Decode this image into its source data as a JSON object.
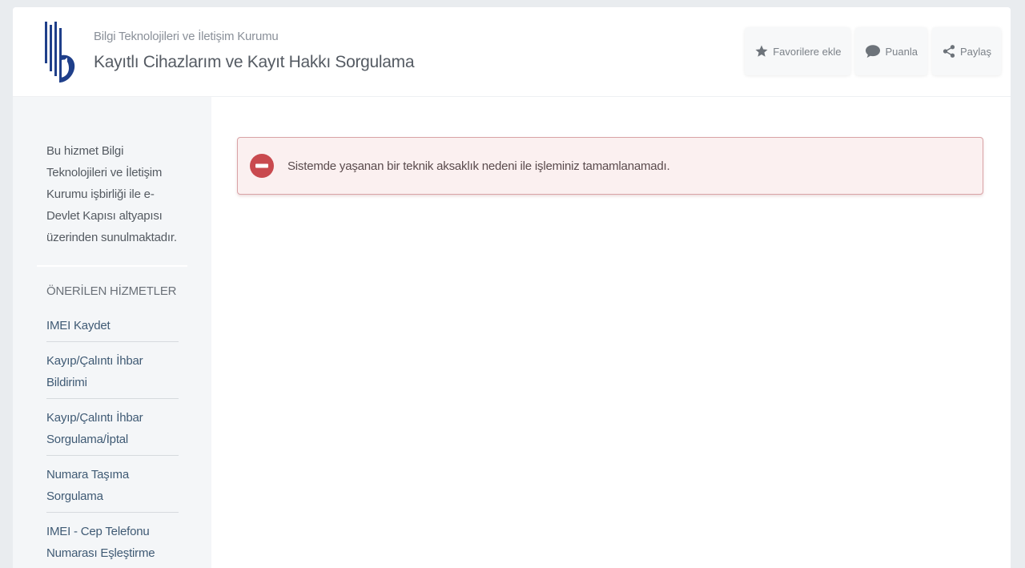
{
  "header": {
    "agency": "Bilgi Teknolojileri ve İletişim Kurumu",
    "title": "Kayıtlı Cihazlarım ve Kayıt Hakkı Sorgulama",
    "actions": [
      {
        "label": "Favorilere ekle",
        "icon": "star-icon"
      },
      {
        "label": "Puanla",
        "icon": "comment-icon"
      },
      {
        "label": "Paylaş",
        "icon": "share-icon"
      }
    ]
  },
  "sidebar": {
    "description": "Bu hizmet Bilgi Teknolojileri ve İletişim Kurumu işbirliği ile e-Devlet Kapısı altyapısı üzerinden sunulmaktadır.",
    "heading": "ÖNERİLEN HİZMETLER",
    "items": [
      {
        "label": "IMEI Kaydet"
      },
      {
        "label": "Kayıp/Çalıntı İhbar Bildirimi"
      },
      {
        "label": "Kayıp/Çalıntı İhbar Sorgulama/İptal"
      },
      {
        "label": "Numara Taşıma Sorgulama"
      },
      {
        "label": "IMEI - Cep Telefonu Numarası Eşleştirme"
      }
    ]
  },
  "alert": {
    "message": "Sistemde yaşanan bir teknik aksaklık nedeni ile işleminiz tamamlanamadı.",
    "icon": "error-icon",
    "color": "#c94a4f"
  }
}
